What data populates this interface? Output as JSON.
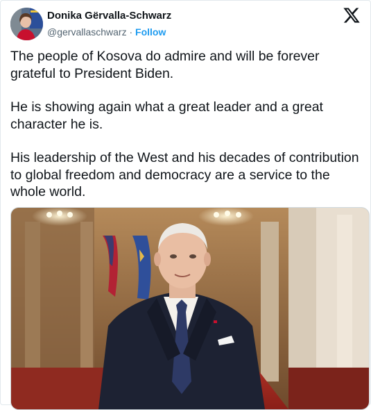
{
  "author": {
    "display_name": "Donika Gërvalla-Schwarz",
    "handle": "@gervallaschwarz",
    "separator": "·",
    "follow_label": "Follow"
  },
  "post": {
    "paragraphs": [
      "The people of Kosova do admire and will be forever grateful to President Biden.",
      "He is showing again what a great leader and a great character he is.",
      "His leadership of the West and his decades of contribution to global freedom and democracy are a service to the whole world."
    ]
  },
  "icons": {
    "x_logo": "x-logo-icon"
  },
  "media": {
    "description": "video-still"
  }
}
